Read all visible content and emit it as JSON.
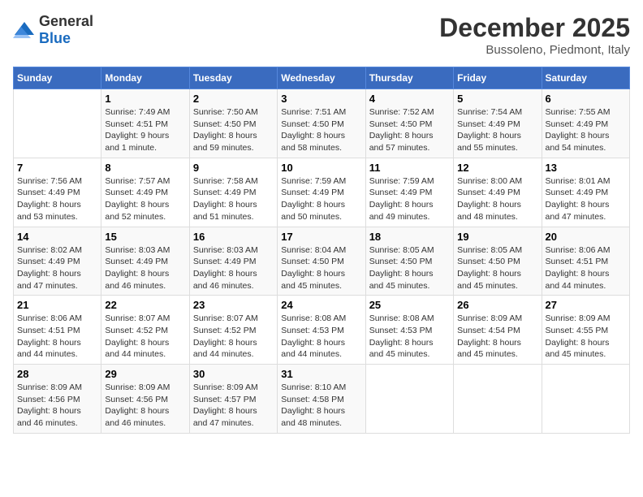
{
  "logo": {
    "general": "General",
    "blue": "Blue"
  },
  "title": "December 2025",
  "subtitle": "Bussoleno, Piedmont, Italy",
  "days_header": [
    "Sunday",
    "Monday",
    "Tuesday",
    "Wednesday",
    "Thursday",
    "Friday",
    "Saturday"
  ],
  "weeks": [
    [
      {
        "day": "",
        "info": ""
      },
      {
        "day": "1",
        "info": "Sunrise: 7:49 AM\nSunset: 4:51 PM\nDaylight: 9 hours\nand 1 minute."
      },
      {
        "day": "2",
        "info": "Sunrise: 7:50 AM\nSunset: 4:50 PM\nDaylight: 8 hours\nand 59 minutes."
      },
      {
        "day": "3",
        "info": "Sunrise: 7:51 AM\nSunset: 4:50 PM\nDaylight: 8 hours\nand 58 minutes."
      },
      {
        "day": "4",
        "info": "Sunrise: 7:52 AM\nSunset: 4:50 PM\nDaylight: 8 hours\nand 57 minutes."
      },
      {
        "day": "5",
        "info": "Sunrise: 7:54 AM\nSunset: 4:49 PM\nDaylight: 8 hours\nand 55 minutes."
      },
      {
        "day": "6",
        "info": "Sunrise: 7:55 AM\nSunset: 4:49 PM\nDaylight: 8 hours\nand 54 minutes."
      }
    ],
    [
      {
        "day": "7",
        "info": "Sunrise: 7:56 AM\nSunset: 4:49 PM\nDaylight: 8 hours\nand 53 minutes."
      },
      {
        "day": "8",
        "info": "Sunrise: 7:57 AM\nSunset: 4:49 PM\nDaylight: 8 hours\nand 52 minutes."
      },
      {
        "day": "9",
        "info": "Sunrise: 7:58 AM\nSunset: 4:49 PM\nDaylight: 8 hours\nand 51 minutes."
      },
      {
        "day": "10",
        "info": "Sunrise: 7:59 AM\nSunset: 4:49 PM\nDaylight: 8 hours\nand 50 minutes."
      },
      {
        "day": "11",
        "info": "Sunrise: 7:59 AM\nSunset: 4:49 PM\nDaylight: 8 hours\nand 49 minutes."
      },
      {
        "day": "12",
        "info": "Sunrise: 8:00 AM\nSunset: 4:49 PM\nDaylight: 8 hours\nand 48 minutes."
      },
      {
        "day": "13",
        "info": "Sunrise: 8:01 AM\nSunset: 4:49 PM\nDaylight: 8 hours\nand 47 minutes."
      }
    ],
    [
      {
        "day": "14",
        "info": "Sunrise: 8:02 AM\nSunset: 4:49 PM\nDaylight: 8 hours\nand 47 minutes."
      },
      {
        "day": "15",
        "info": "Sunrise: 8:03 AM\nSunset: 4:49 PM\nDaylight: 8 hours\nand 46 minutes."
      },
      {
        "day": "16",
        "info": "Sunrise: 8:03 AM\nSunset: 4:49 PM\nDaylight: 8 hours\nand 46 minutes."
      },
      {
        "day": "17",
        "info": "Sunrise: 8:04 AM\nSunset: 4:50 PM\nDaylight: 8 hours\nand 45 minutes."
      },
      {
        "day": "18",
        "info": "Sunrise: 8:05 AM\nSunset: 4:50 PM\nDaylight: 8 hours\nand 45 minutes."
      },
      {
        "day": "19",
        "info": "Sunrise: 8:05 AM\nSunset: 4:50 PM\nDaylight: 8 hours\nand 45 minutes."
      },
      {
        "day": "20",
        "info": "Sunrise: 8:06 AM\nSunset: 4:51 PM\nDaylight: 8 hours\nand 44 minutes."
      }
    ],
    [
      {
        "day": "21",
        "info": "Sunrise: 8:06 AM\nSunset: 4:51 PM\nDaylight: 8 hours\nand 44 minutes."
      },
      {
        "day": "22",
        "info": "Sunrise: 8:07 AM\nSunset: 4:52 PM\nDaylight: 8 hours\nand 44 minutes."
      },
      {
        "day": "23",
        "info": "Sunrise: 8:07 AM\nSunset: 4:52 PM\nDaylight: 8 hours\nand 44 minutes."
      },
      {
        "day": "24",
        "info": "Sunrise: 8:08 AM\nSunset: 4:53 PM\nDaylight: 8 hours\nand 44 minutes."
      },
      {
        "day": "25",
        "info": "Sunrise: 8:08 AM\nSunset: 4:53 PM\nDaylight: 8 hours\nand 45 minutes."
      },
      {
        "day": "26",
        "info": "Sunrise: 8:09 AM\nSunset: 4:54 PM\nDaylight: 8 hours\nand 45 minutes."
      },
      {
        "day": "27",
        "info": "Sunrise: 8:09 AM\nSunset: 4:55 PM\nDaylight: 8 hours\nand 45 minutes."
      }
    ],
    [
      {
        "day": "28",
        "info": "Sunrise: 8:09 AM\nSunset: 4:56 PM\nDaylight: 8 hours\nand 46 minutes."
      },
      {
        "day": "29",
        "info": "Sunrise: 8:09 AM\nSunset: 4:56 PM\nDaylight: 8 hours\nand 46 minutes."
      },
      {
        "day": "30",
        "info": "Sunrise: 8:09 AM\nSunset: 4:57 PM\nDaylight: 8 hours\nand 47 minutes."
      },
      {
        "day": "31",
        "info": "Sunrise: 8:10 AM\nSunset: 4:58 PM\nDaylight: 8 hours\nand 48 minutes."
      },
      {
        "day": "",
        "info": ""
      },
      {
        "day": "",
        "info": ""
      },
      {
        "day": "",
        "info": ""
      }
    ]
  ]
}
